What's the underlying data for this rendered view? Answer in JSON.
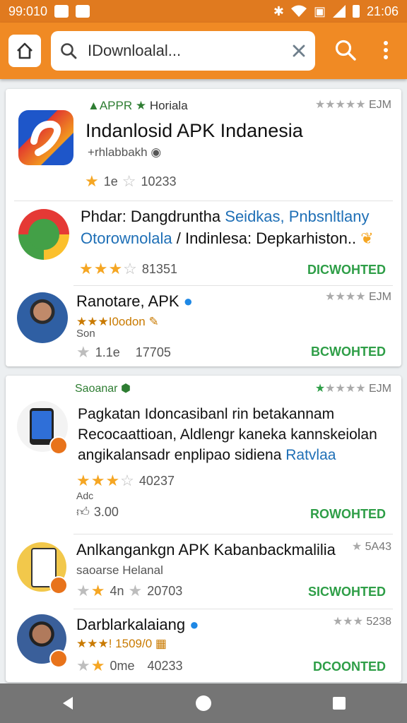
{
  "status_bar": {
    "time_left": "99:010",
    "time_right": "21:06"
  },
  "search": {
    "value": "IDownloalal..."
  },
  "featured": {
    "publisher": "APPR",
    "publisher_extra": "Horiala",
    "meta": "EJM",
    "title": "Indanlosid APK Indanesia",
    "developer": "rhlabbakh",
    "rating_text": "1e",
    "downloads": "10233"
  },
  "card1_items": [
    {
      "line1_prefix": "Phdar: Dangdruntha ",
      "line1_link": "Seidkas, Pnbsnltlany",
      "line2_link": "Otorownolala",
      "line2_mid": " / Indinlesa: ",
      "line2_tail": "Depkarhiston..",
      "downloads": "81351",
      "status": "DICWOHTED"
    },
    {
      "title": "Ranotare, APK",
      "meta": "EJM",
      "subtitle": "I0odon",
      "subtitle2": "Son",
      "rating_text": "1.1e",
      "downloads": "17705",
      "status": "BCWOHTED"
    }
  ],
  "card2": {
    "section_label": "Saoanar",
    "meta": "EJM",
    "items": [
      {
        "line1": "Pagkatan Idoncasibanl rin betakannam",
        "line2": "Recocaattioan, Aldlengr kaneka kannskeiolan",
        "line3_text": "angikalansadr enplipao sidiena ",
        "line3_link": "Ratvlaa",
        "downloads": "40237",
        "sub_small": "Adc",
        "likes": "3.00",
        "status": "ROWOHTED"
      },
      {
        "title": "Anlkangankgn APK Kabanbackmalilia",
        "meta": "5A43",
        "subtitle": "saoarse Helanal",
        "rating_text": "4n",
        "downloads": "20703",
        "status": "SICWOHTED"
      },
      {
        "title": "Darblarkalaiang",
        "meta": "5238",
        "subtitle": "1509/0",
        "rating_text": "0me",
        "downloads": "40233",
        "status": "DCOONTED"
      }
    ]
  },
  "colors": {
    "accent": "#f08a24",
    "green": "#2e9e47",
    "link": "#1e6fb6",
    "star": "#f5a623"
  }
}
